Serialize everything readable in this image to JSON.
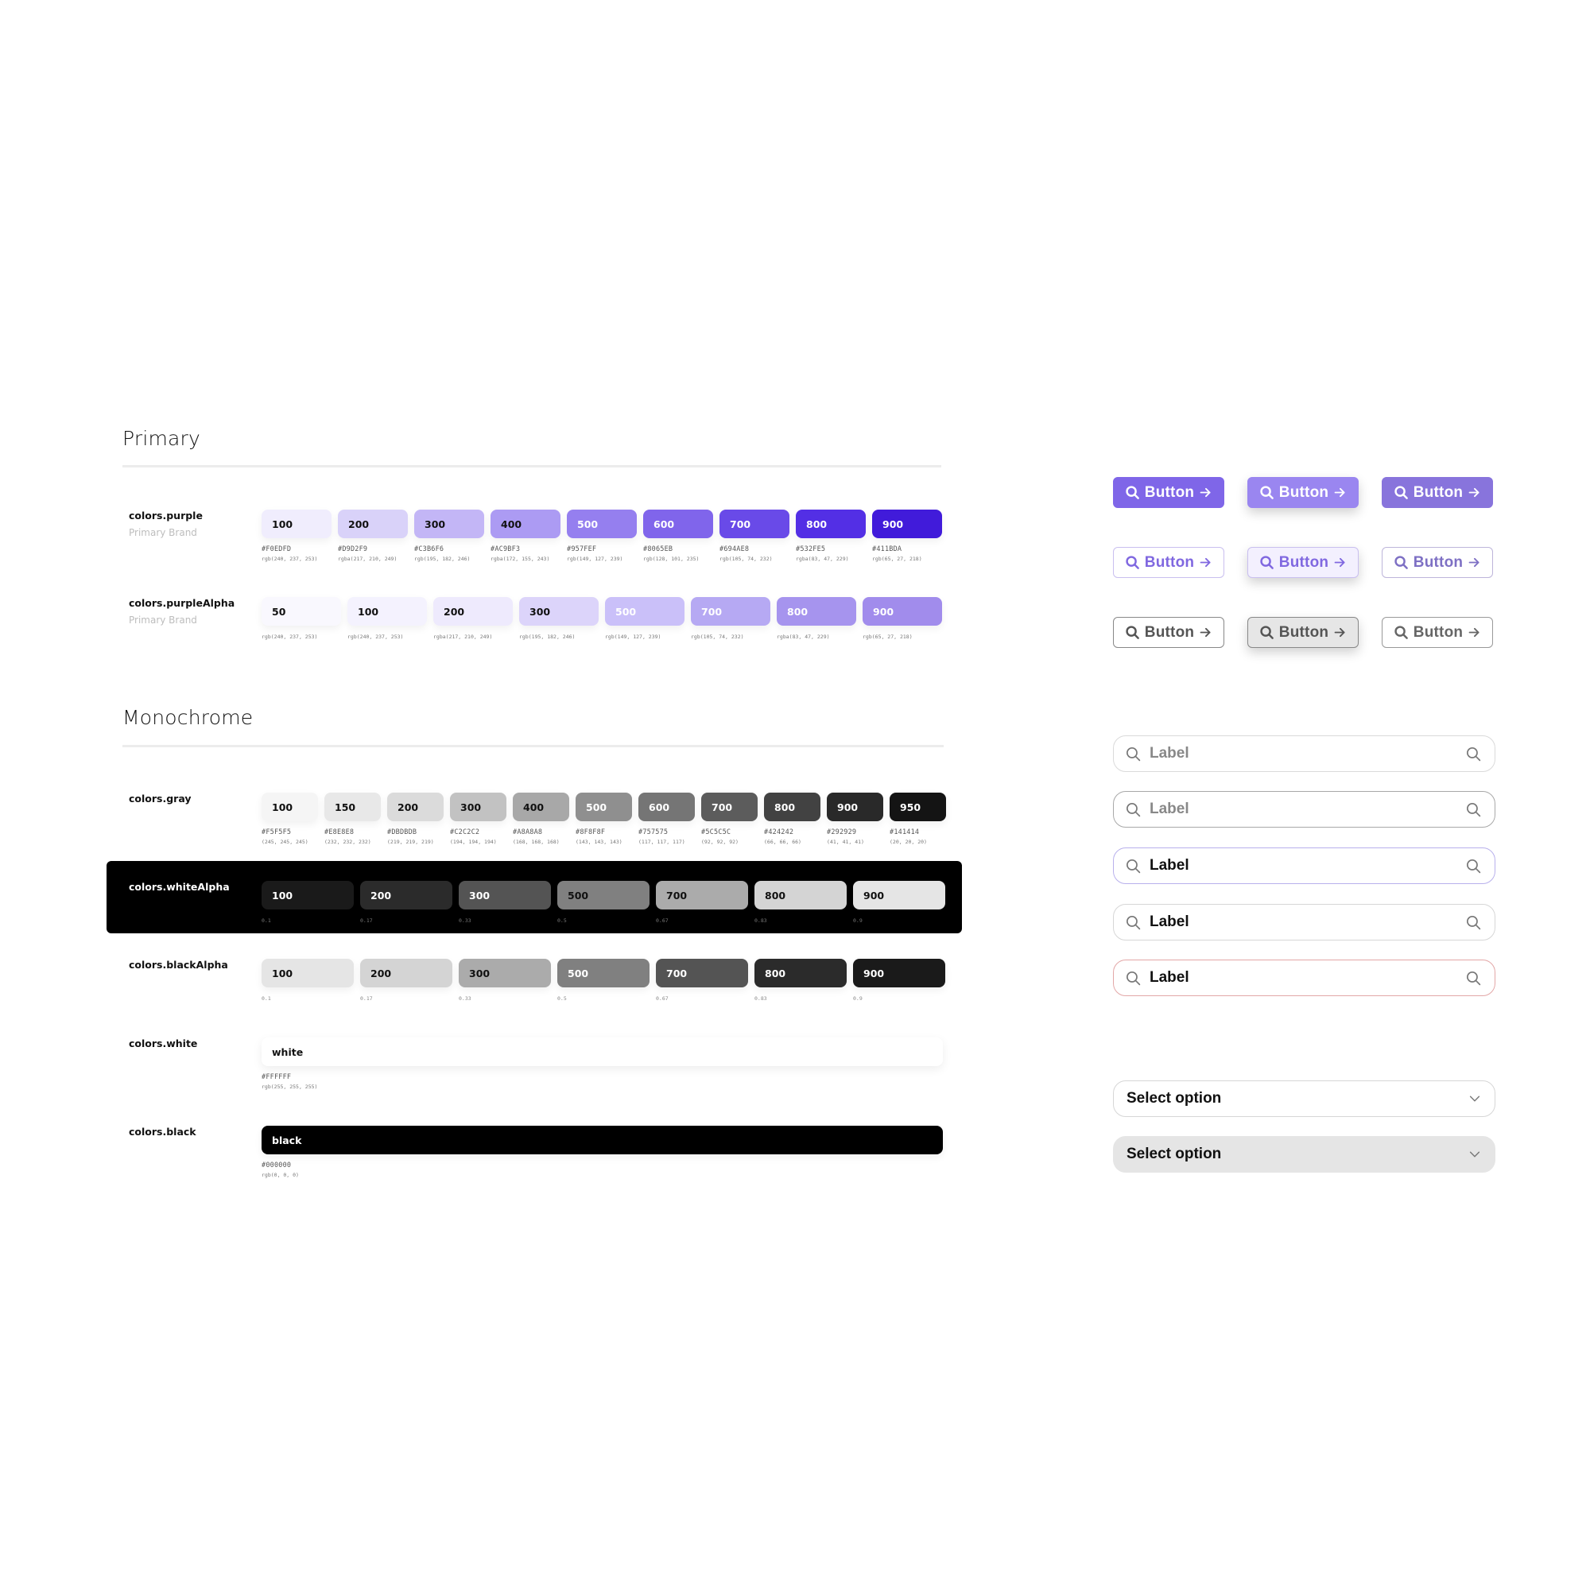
{
  "sections": {
    "primary": "Primary",
    "monochrome": "Monochrome"
  },
  "purple": {
    "name": "colors.purple",
    "subtitle": "Primary Brand",
    "swatches": [
      {
        "label": "100",
        "hex": "#F0EDFD",
        "rgb": "rgb(240, 237, 253)",
        "color": "#F0EDFD",
        "text": "#111111"
      },
      {
        "label": "200",
        "hex": "#D9D2F9",
        "rgb": "rgba(217, 210, 249)",
        "color": "#D9D2F9",
        "text": "#111111"
      },
      {
        "label": "300",
        "hex": "#C3B6F6",
        "rgb": "rgb(195, 182, 246)",
        "color": "#C3B6F6",
        "text": "#111111"
      },
      {
        "label": "400",
        "hex": "#AC9BF3",
        "rgb": "rgba(172, 155, 243)",
        "color": "#AC9BF3",
        "text": "#111111"
      },
      {
        "label": "500",
        "hex": "#957FEF",
        "rgb": "rgb(149, 127, 239)",
        "color": "#957FEF",
        "text": "#FFFFFF"
      },
      {
        "label": "600",
        "hex": "#8065EB",
        "rgb": "rgb(128, 101, 235)",
        "color": "#8065EB",
        "text": "#FFFFFF"
      },
      {
        "label": "700",
        "hex": "#694AE8",
        "rgb": "rgb(105, 74, 232)",
        "color": "#694AE8",
        "text": "#FFFFFF"
      },
      {
        "label": "800",
        "hex": "#532FE5",
        "rgb": "rgba(83, 47, 229)",
        "color": "#532FE5",
        "text": "#FFFFFF"
      },
      {
        "label": "900",
        "hex": "#411BDA",
        "rgb": "rgb(65, 27, 218)",
        "color": "#411BDA",
        "text": "#FFFFFF"
      }
    ]
  },
  "purpleAlpha": {
    "name": "colors.purpleAlpha",
    "subtitle": "Primary Brand",
    "swatches": [
      {
        "label": "50",
        "rgb": "rgb(240, 237, 253)",
        "color": "#F9F8FE",
        "text": "#111111"
      },
      {
        "label": "100",
        "rgb": "rgb(240, 237, 253)",
        "color": "#F4F2FE",
        "text": "#111111"
      },
      {
        "label": "200",
        "rgb": "rgba(217, 210, 249)",
        "color": "#EEEAFD",
        "text": "#111111"
      },
      {
        "label": "300",
        "rgb": "rgb(195, 182, 246)",
        "color": "#DCD4FA",
        "text": "#111111"
      },
      {
        "label": "500",
        "rgb": "rgb(149, 127, 239)",
        "color": "#CAC0F9",
        "text": "#FFFFFF"
      },
      {
        "label": "700",
        "rgb": "rgb(105, 74, 232)",
        "color": "#B6A9F3",
        "text": "#FFFFFF"
      },
      {
        "label": "800",
        "rgb": "rgba(83, 47, 229)",
        "color": "#A694EE",
        "text": "#FFFFFF"
      },
      {
        "label": "900",
        "rgb": "rgb(65, 27, 218)",
        "color": "#A18CEC",
        "text": "#FFFFFF"
      }
    ]
  },
  "gray": {
    "name": "colors.gray",
    "swatches": [
      {
        "label": "100",
        "hex": "#F5F5F5",
        "rgb": "(245, 245, 245)",
        "color": "#F5F5F5",
        "text": "#111111"
      },
      {
        "label": "150",
        "hex": "#E8E8E8",
        "rgb": "(232, 232, 232)",
        "color": "#E8E8E8",
        "text": "#111111"
      },
      {
        "label": "200",
        "hex": "#DBDBDB",
        "rgb": "(219, 219, 219)",
        "color": "#DBDBDB",
        "text": "#111111"
      },
      {
        "label": "300",
        "hex": "#C2C2C2",
        "rgb": "(194, 194, 194)",
        "color": "#C2C2C2",
        "text": "#111111"
      },
      {
        "label": "400",
        "hex": "#A8A8A8",
        "rgb": "(168, 168, 168)",
        "color": "#A8A8A8",
        "text": "#111111"
      },
      {
        "label": "500",
        "hex": "#8F8F8F",
        "rgb": "(143, 143, 143)",
        "color": "#8F8F8F",
        "text": "#FFFFFF"
      },
      {
        "label": "600",
        "hex": "#757575",
        "rgb": "(117, 117, 117)",
        "color": "#757575",
        "text": "#FFFFFF"
      },
      {
        "label": "700",
        "hex": "#5C5C5C",
        "rgb": "(92, 92, 92)",
        "color": "#5C5C5C",
        "text": "#FFFFFF"
      },
      {
        "label": "800",
        "hex": "#424242",
        "rgb": "(66, 66, 66)",
        "color": "#424242",
        "text": "#FFFFFF"
      },
      {
        "label": "900",
        "hex": "#292929",
        "rgb": "(41, 41, 41)",
        "color": "#292929",
        "text": "#FFFFFF"
      },
      {
        "label": "950",
        "hex": "#141414",
        "rgb": "(20, 20, 20)",
        "color": "#141414",
        "text": "#FFFFFF"
      }
    ]
  },
  "whiteAlpha": {
    "name": "colors.whiteAlpha",
    "swatches": [
      {
        "label": "100",
        "alpha": "0.1",
        "color": "#1A1A1A",
        "text": "#FFFFFF"
      },
      {
        "label": "200",
        "alpha": "0.17",
        "color": "#2B2B2B",
        "text": "#FFFFFF"
      },
      {
        "label": "300",
        "alpha": "0.33",
        "color": "#545454",
        "text": "#FFFFFF"
      },
      {
        "label": "500",
        "alpha": "0.5",
        "color": "#808080",
        "text": "#111111"
      },
      {
        "label": "700",
        "alpha": "0.67",
        "color": "#ABABAB",
        "text": "#111111"
      },
      {
        "label": "800",
        "alpha": "0.83",
        "color": "#D4D4D4",
        "text": "#111111"
      },
      {
        "label": "900",
        "alpha": "0.9",
        "color": "#E5E5E5",
        "text": "#111111"
      }
    ]
  },
  "blackAlpha": {
    "name": "colors.blackAlpha",
    "swatches": [
      {
        "label": "100",
        "alpha": "0.1",
        "color": "#E5E5E5",
        "text": "#111111"
      },
      {
        "label": "200",
        "alpha": "0.17",
        "color": "#D4D4D4",
        "text": "#111111"
      },
      {
        "label": "300",
        "alpha": "0.33",
        "color": "#ABABAB",
        "text": "#111111"
      },
      {
        "label": "500",
        "alpha": "0.5",
        "color": "#808080",
        "text": "#FFFFFF"
      },
      {
        "label": "700",
        "alpha": "0.67",
        "color": "#545454",
        "text": "#FFFFFF"
      },
      {
        "label": "800",
        "alpha": "0.83",
        "color": "#2B2B2B",
        "text": "#FFFFFF"
      },
      {
        "label": "900",
        "alpha": "0.9",
        "color": "#1A1A1A",
        "text": "#FFFFFF"
      }
    ]
  },
  "white": {
    "name": "colors.white",
    "label": "white",
    "hex": "#FFFFFF",
    "rgb": "rgb(255, 255, 255)"
  },
  "black": {
    "name": "colors.black",
    "label": "black",
    "hex": "#000000",
    "rgb": "rgb(0, 0, 0)"
  },
  "buttons": {
    "label": "Button",
    "rows": [
      [
        {
          "state": "default",
          "bg": "#7F66E8",
          "fg": "#FFFFFF",
          "border": "#7F66E8"
        },
        {
          "state": "hover",
          "bg": "#9A86F0",
          "fg": "#FFFFFF",
          "border": "#9A86F0"
        },
        {
          "state": "pressed",
          "bg": "#8874DC",
          "fg": "#FFFFFF",
          "border": "#8874DC"
        }
      ],
      [
        {
          "state": "default",
          "bg": "#FFFFFF",
          "fg": "#8068E0",
          "border": "#C9BFEF"
        },
        {
          "state": "hover",
          "bg": "#F3F0FE",
          "fg": "#8068E0",
          "border": "#C9BFEF"
        },
        {
          "state": "pressed",
          "bg": "#FFFFFF",
          "fg": "#7E70C4",
          "border": "#BDB5DA"
        }
      ],
      [
        {
          "state": "default",
          "bg": "#FFFFFF",
          "fg": "#555555",
          "border": "#888888"
        },
        {
          "state": "hover",
          "bg": "#E6E6E6",
          "fg": "#555555",
          "border": "#888888"
        },
        {
          "state": "pressed",
          "bg": "#FFFFFF",
          "fg": "#666666",
          "border": "#999999"
        }
      ]
    ]
  },
  "inputs": [
    {
      "label": "Label",
      "state": "placeholder",
      "border": "#DADADA",
      "text": "#888888"
    },
    {
      "label": "Label",
      "state": "hover",
      "border": "#A8A8A8",
      "text": "#888888"
    },
    {
      "label": "Label",
      "state": "focused",
      "border": "#B8B0EC",
      "text": "#111111"
    },
    {
      "label": "Label",
      "state": "filled",
      "border": "#D6D6D6",
      "text": "#111111"
    },
    {
      "label": "Label",
      "state": "error",
      "border": "#E3A7A7",
      "text": "#111111"
    }
  ],
  "selects": [
    {
      "label": "Select option",
      "variant": "outline",
      "bg": "#FFFFFF",
      "border": "#D6D6D6"
    },
    {
      "label": "Select option",
      "variant": "filled",
      "bg": "#E5E5E5",
      "border": "#E5E5E5"
    }
  ]
}
